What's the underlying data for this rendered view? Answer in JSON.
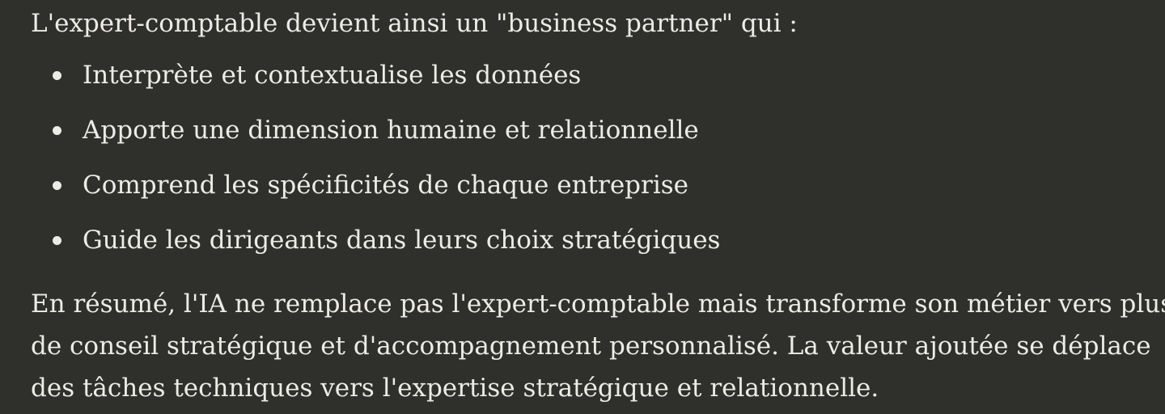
{
  "content": {
    "intro": "L'expert-comptable devient ainsi un \"business partner\" qui :",
    "bullets": [
      "Interprète et contextualise les données",
      "Apporte une dimension humaine et relationnelle",
      "Comprend les spécificités de chaque entreprise",
      "Guide les dirigeants dans leurs choix stratégiques"
    ],
    "summary_lines": [
      "En résumé, l'IA ne remplace pas l'expert-comptable mais transforme son métier vers plus",
      "de conseil stratégique et d'accompagnement personnalisé. La valeur ajoutée se déplace",
      "des tâches techniques vers l'expertise stratégique et relationnelle."
    ]
  }
}
